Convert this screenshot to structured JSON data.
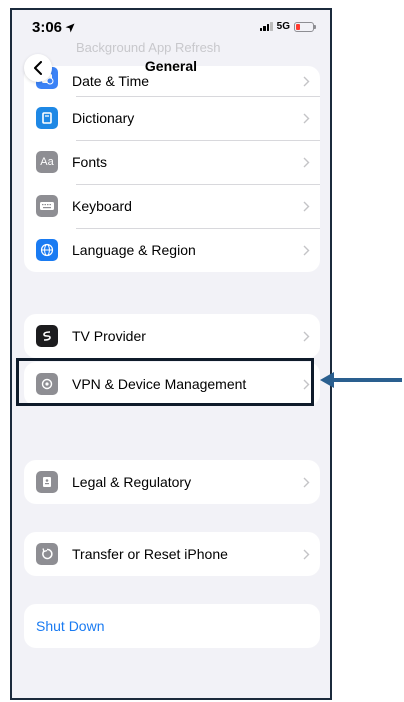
{
  "status_bar": {
    "time": "3:06",
    "network": "5G"
  },
  "ghost_row": {
    "label": "Background App Refresh"
  },
  "nav": {
    "title": "General"
  },
  "groups": {
    "g1": [
      {
        "label": "Date & Time",
        "icon": "calendar-clock-icon",
        "color": "#3b82f6"
      },
      {
        "label": "Dictionary",
        "icon": "book-icon",
        "color": "#1e88e5"
      },
      {
        "label": "Fonts",
        "icon": "font-icon",
        "color": "#8e8e93",
        "glyph": "Aa"
      },
      {
        "label": "Keyboard",
        "icon": "keyboard-icon",
        "color": "#8e8e93"
      },
      {
        "label": "Language & Region",
        "icon": "globe-icon",
        "color": "#1a7bf2"
      }
    ],
    "g2": [
      {
        "label": "TV Provider",
        "icon": "tv-provider-icon",
        "color": "#1c1c1e"
      }
    ],
    "g3": [
      {
        "label": "VPN & Device Management",
        "icon": "gear-icon",
        "color": "#8e8e93"
      }
    ],
    "g4": [
      {
        "label": "Legal & Regulatory",
        "icon": "legal-icon",
        "color": "#8e8e93"
      }
    ],
    "g5": [
      {
        "label": "Transfer or Reset iPhone",
        "icon": "reset-icon",
        "color": "#8e8e93"
      }
    ],
    "g6": [
      {
        "label": "Shut Down"
      }
    ]
  },
  "colors": {
    "accent": "#1a7bf2",
    "highlight_border": "#0f1b2a",
    "arrow": "#2a5f8f"
  }
}
